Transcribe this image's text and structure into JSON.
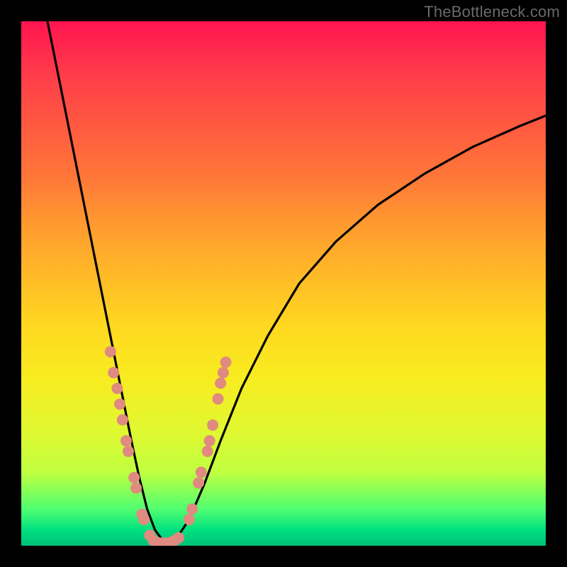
{
  "watermark": "TheBottleneck.com",
  "chart_data": {
    "type": "line",
    "title": "",
    "xlabel": "",
    "ylabel": "",
    "xlim": [
      0,
      100
    ],
    "ylim": [
      0,
      100
    ],
    "grid": false,
    "legend": false,
    "annotations": [],
    "background_gradient_meaning": "red=high bottleneck, green=optimal",
    "series": [
      {
        "name": "bottleneck-curve",
        "color": "#000000",
        "x": [
          5,
          8,
          11,
          14,
          17,
          19,
          21,
          22.5,
          24,
          25.5,
          27,
          28,
          29,
          32,
          35,
          38,
          42,
          47,
          53,
          60,
          68,
          77,
          86,
          95,
          100
        ],
        "y": [
          100,
          85,
          70,
          55,
          40,
          30,
          20,
          13,
          7,
          3,
          1,
          0,
          0.5,
          5,
          12,
          20,
          30,
          40,
          50,
          58,
          65,
          71,
          76,
          80,
          82
        ]
      }
    ],
    "scatter_overlay": {
      "name": "sample-hardware-points",
      "color": "#e08a80",
      "points": [
        {
          "x": 17.0,
          "y": 37
        },
        {
          "x": 17.6,
          "y": 33
        },
        {
          "x": 18.3,
          "y": 30
        },
        {
          "x": 18.8,
          "y": 27
        },
        {
          "x": 19.3,
          "y": 24
        },
        {
          "x": 20.0,
          "y": 20
        },
        {
          "x": 20.4,
          "y": 18
        },
        {
          "x": 21.5,
          "y": 13
        },
        {
          "x": 21.9,
          "y": 11
        },
        {
          "x": 23.0,
          "y": 6
        },
        {
          "x": 23.4,
          "y": 5
        },
        {
          "x": 24.5,
          "y": 2
        },
        {
          "x": 25.2,
          "y": 1
        },
        {
          "x": 26.0,
          "y": 0.6
        },
        {
          "x": 26.8,
          "y": 0.5
        },
        {
          "x": 27.6,
          "y": 0.5
        },
        {
          "x": 28.4,
          "y": 0.6
        },
        {
          "x": 29.2,
          "y": 1.0
        },
        {
          "x": 30.0,
          "y": 1.5
        },
        {
          "x": 32.0,
          "y": 5
        },
        {
          "x": 32.6,
          "y": 7
        },
        {
          "x": 33.8,
          "y": 12
        },
        {
          "x": 34.3,
          "y": 14
        },
        {
          "x": 35.5,
          "y": 18
        },
        {
          "x": 35.9,
          "y": 20
        },
        {
          "x": 36.5,
          "y": 23
        },
        {
          "x": 37.5,
          "y": 28
        },
        {
          "x": 38.0,
          "y": 31
        },
        {
          "x": 38.5,
          "y": 33
        },
        {
          "x": 39.0,
          "y": 35
        }
      ]
    }
  }
}
